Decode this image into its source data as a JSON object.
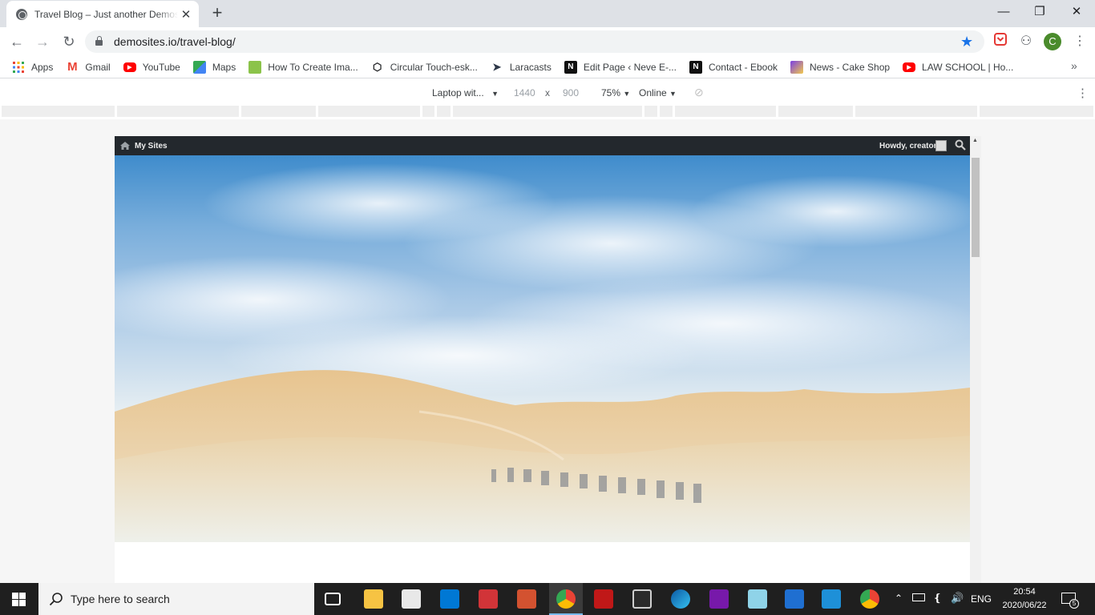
{
  "browser": {
    "tab_title": "Travel Blog – Just another Demosites",
    "url": "demosites.io/travel-blog/",
    "avatar_letter": "C",
    "bookmarks": [
      {
        "label": "Apps",
        "icon": "apps-grid-icon",
        "color": "#ea4335"
      },
      {
        "label": "Gmail",
        "icon": "gmail-icon",
        "color": "#ea4335"
      },
      {
        "label": "YouTube",
        "icon": "youtube-icon",
        "color": "#ff0000"
      },
      {
        "label": "Maps",
        "icon": "maps-icon",
        "color": "#34a853"
      },
      {
        "label": "How To Create Ima...",
        "icon": "bookmark-favicon-icon",
        "color": "#8bc34a"
      },
      {
        "label": "Circular Touch-esk...",
        "icon": "codepen-icon",
        "color": "#202124"
      },
      {
        "label": "Laracasts",
        "icon": "laracasts-icon",
        "color": "#2d3748"
      },
      {
        "label": "Edit Page ‹ Neve E-...",
        "icon": "neve-icon",
        "color": "#111111"
      },
      {
        "label": "Contact - Ebook",
        "icon": "neve-icon",
        "color": "#111111"
      },
      {
        "label": "News - Cake Shop",
        "icon": "cake-shop-icon",
        "color": "#7b3fe4"
      },
      {
        "label": "LAW SCHOOL | Ho...",
        "icon": "youtube-icon",
        "color": "#ff0000"
      }
    ]
  },
  "devtools": {
    "device": "Laptop wit...",
    "width": "1440",
    "times": "x",
    "height": "900",
    "zoom": "75%",
    "network": "Online"
  },
  "site": {
    "admin_my_sites": "My Sites",
    "admin_howdy": "Howdy, creator"
  },
  "taskbar": {
    "search_placeholder": "Type here to search",
    "language": "ENG",
    "time": "20:54",
    "date": "2020/06/22",
    "notification_count": "5"
  }
}
